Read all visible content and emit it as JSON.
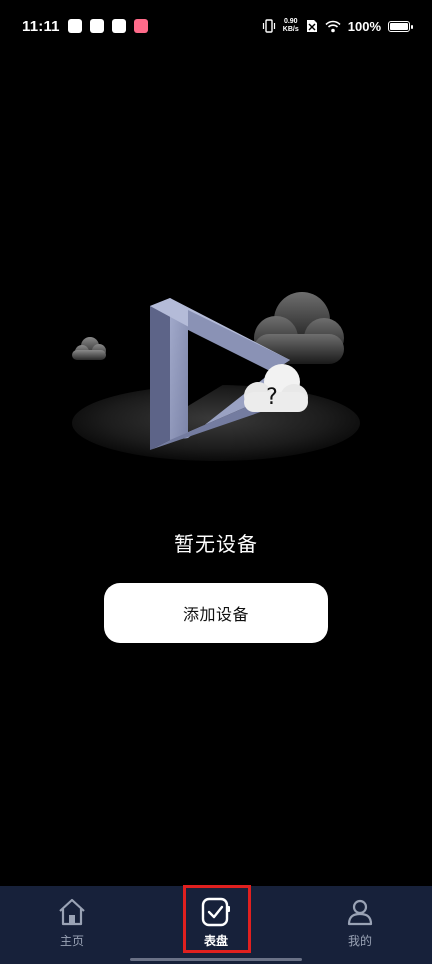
{
  "status_bar": {
    "time": "11:11",
    "net_speed_value": "0.90",
    "net_speed_unit": "KB/s",
    "battery_percent": "100%"
  },
  "main": {
    "empty_message": "暂无设备",
    "add_device_label": "添加设备"
  },
  "bottom_nav": {
    "items": [
      {
        "label": "主页",
        "icon": "home-icon"
      },
      {
        "label": "表盘",
        "icon": "watch-face-icon"
      },
      {
        "label": "我的",
        "icon": "profile-icon"
      }
    ],
    "active_index": 1
  },
  "colors": {
    "background": "#000000",
    "nav_background": "#17213a",
    "highlight": "#e0201f",
    "illustration_shape": "#8f97b8"
  }
}
